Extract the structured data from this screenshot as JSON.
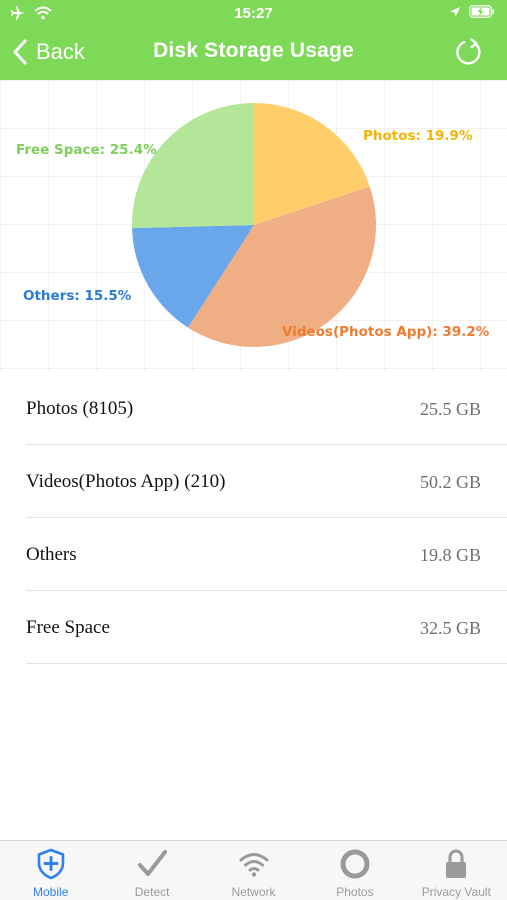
{
  "status_bar": {
    "time": "15:27"
  },
  "nav": {
    "back_label": "Back",
    "title": "Disk Storage Usage"
  },
  "chart_data": {
    "type": "pie",
    "slices": [
      {
        "label": "Photos: 19.9%",
        "category": "Photos",
        "value": 19.9,
        "color": "#ffce6b",
        "label_color": "#f5b400"
      },
      {
        "label": "Videos(Photos App): 39.2%",
        "category": "Videos(Photos App)",
        "value": 39.2,
        "color": "#efae84",
        "label_color": "#f07a2e"
      },
      {
        "label": "Others: 15.5%",
        "category": "Others",
        "value": 15.5,
        "color": "#6aa6ea",
        "label_color": "#2a7ad8"
      },
      {
        "label": "Free Space: 25.4%",
        "category": "Free Space",
        "value": 25.4,
        "color": "#b3e699",
        "label_color": "#7ecf5b"
      }
    ]
  },
  "storage_list": [
    {
      "name": "Photos (8105)",
      "size": "25.5 GB"
    },
    {
      "name": "Videos(Photos App) (210)",
      "size": "50.2 GB"
    },
    {
      "name": "Others",
      "size": "19.8 GB"
    },
    {
      "name": "Free Space",
      "size": "32.5 GB"
    }
  ],
  "tabs": [
    {
      "label": "Mobile",
      "icon": "shield-plus-icon",
      "active": true
    },
    {
      "label": "Detect",
      "icon": "checkmark-icon",
      "active": false
    },
    {
      "label": "Network",
      "icon": "wifi-icon",
      "active": false
    },
    {
      "label": "Photos",
      "icon": "ring-icon",
      "active": false
    },
    {
      "label": "Privacy Vault",
      "icon": "lock-icon",
      "active": false
    }
  ],
  "colors": {
    "header_bg": "#7dd957",
    "active_tab": "#2f7ff0",
    "inactive_tab": "#9a9a9a"
  }
}
